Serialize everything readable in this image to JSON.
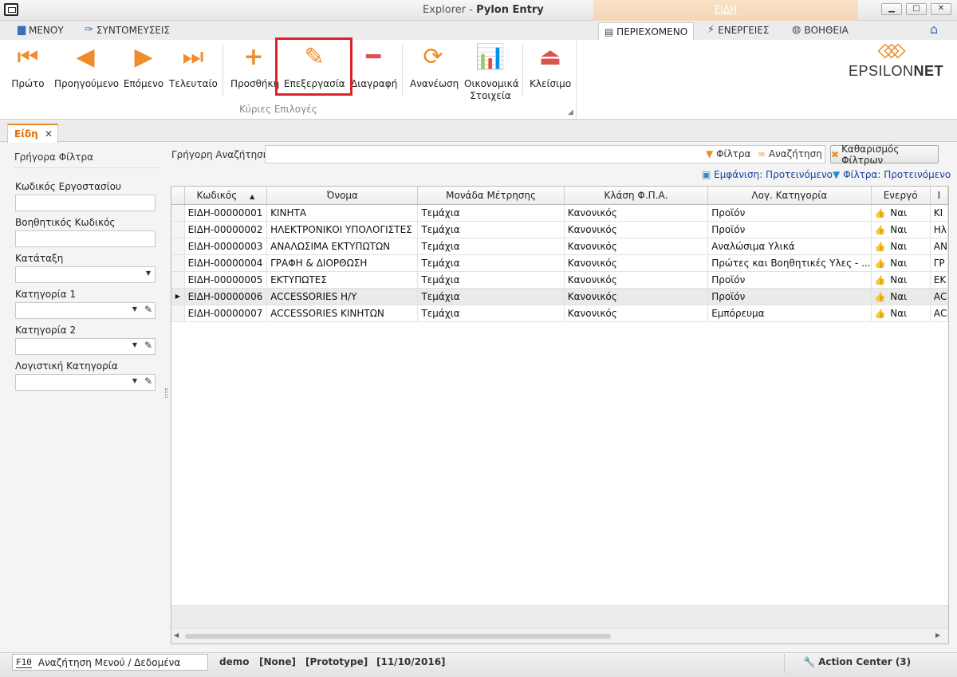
{
  "window": {
    "title_light": "Explorer - ",
    "title_bold": "Pylon Entry",
    "context_tab": "ΕΙΔΗ"
  },
  "window_buttons": {
    "minimize": "▁",
    "maximize": "□",
    "close": "✕"
  },
  "menubar": {
    "menu": "ΜΕΝΟΥ",
    "shortcuts": "ΣΥΝΤΟΜΕΥΣΕΙΣ",
    "content": "ΠΕΡΙΕΧΟΜΕΝΟ",
    "actions": "ΕΝΕΡΓΕΙΕΣ",
    "help": "ΒΟΗΘΕΙΑ"
  },
  "ribbon": {
    "first": "Πρώτο",
    "previous": "Προηγούμενο",
    "next": "Επόμενο",
    "last": "Τελευταίο",
    "add": "Προσθήκη",
    "edit": "Επεξεργασία",
    "delete": "Διαγραφή",
    "refresh": "Ανανέωση",
    "financial_line1": "Οικονομικά",
    "financial_line2": "Στοιχεία",
    "close": "Κλείσιμο",
    "group_label": "Κύριες Επιλογές"
  },
  "logo": {
    "text1": "EPSILON",
    "text2": "NET"
  },
  "doc_tab": {
    "label": "Είδη",
    "close": "✕"
  },
  "left_panel": {
    "title": "Γρήγορα Φίλτρα",
    "factory_code": "Κωδικός Εργοστασίου",
    "aux_code": "Βοηθητικός Κωδικός",
    "classification": "Κατάταξη",
    "category1": "Κατηγορία 1",
    "category2": "Κατηγορία 2",
    "accounting_category": "Λογιστική Κατηγορία"
  },
  "search": {
    "label": "Γρήγορη Αναζήτηση",
    "filters": "Φίλτρα",
    "search": "Αναζήτηση",
    "clear": "Καθαρισμός Φίλτρων"
  },
  "view_links": {
    "view": "Εμφάνιση: Προτεινόμενο",
    "filters": "Φίλτρα: Προτεινόμενο"
  },
  "grid": {
    "columns": [
      "Κωδικός",
      "Όνομα",
      "Μονάδα Μέτρησης",
      "Κλάση Φ.Π.Α.",
      "Λογ. Κατηγορία",
      "Ενεργό",
      "Ι"
    ],
    "rows": [
      [
        "ΕΙΔΗ-00000001",
        "ΚΙΝΗΤΑ",
        "Τεμάχια",
        "Κανονικός",
        "Προϊόν",
        "Ναι",
        "ΚΙ"
      ],
      [
        "ΕΙΔΗ-00000002",
        "ΗΛΕΚΤΡΟΝΙΚΟΙ ΥΠΟΛΟΓΙΣΤΕΣ",
        "Τεμάχια",
        "Κανονικός",
        "Προϊόν",
        "Ναι",
        "Ηλ"
      ],
      [
        "ΕΙΔΗ-00000003",
        "ΑΝΑΛΩΣΙΜΑ ΕΚΤΥΠΩΤΩΝ",
        "Τεμάχια",
        "Κανονικός",
        "Αναλώσιμα Υλικά",
        "Ναι",
        "ΑΝ"
      ],
      [
        "ΕΙΔΗ-00000004",
        "ΓΡΑΦΗ & ΔΙΟΡΘΩΣΗ",
        "Τεμάχια",
        "Κανονικός",
        "Πρώτες και Βοηθητικές Υλες - ...",
        "Ναι",
        "ΓΡ"
      ],
      [
        "ΕΙΔΗ-00000005",
        "ΕΚΤΥΠΩΤΕΣ",
        "Τεμάχια",
        "Κανονικός",
        "Προϊόν",
        "Ναι",
        "ΕΚ"
      ],
      [
        "ΕΙΔΗ-00000006",
        "ACCESSORIES Η/Υ",
        "Τεμάχια",
        "Κανονικός",
        "Προϊόν",
        "Ναι",
        "ΑС"
      ],
      [
        "ΕΙΔΗ-00000007",
        "ACCESSORIES ΚΙΝΗΤΩΝ",
        "Τεμάχια",
        "Κανονικός",
        "Εμπόρευμα",
        "Ναι",
        "ΑС"
      ]
    ]
  },
  "status": {
    "f10_key": "F10",
    "f10_label": "Αναζήτηση Μενού / Δεδομένα",
    "user": "demo",
    "none": "[None]",
    "prototype": "[Prototype]",
    "date": "[11/10/2016]",
    "action_center": "Action Center (3)"
  }
}
